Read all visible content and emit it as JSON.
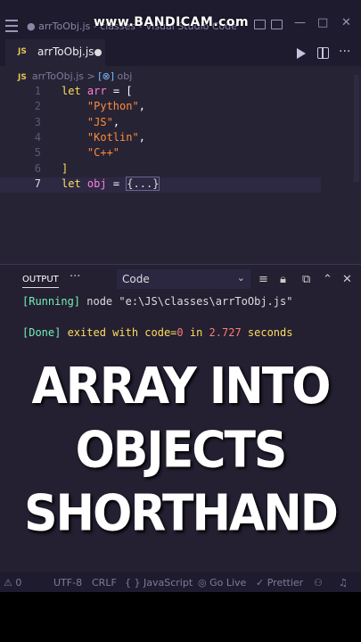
{
  "window": {
    "title": "● arrToObj.js - classes - Visual Studio Code",
    "watermark": "www.BANDICAM.com",
    "controls": [
      "—",
      "□",
      "✕"
    ]
  },
  "tab": {
    "badge": "JS",
    "label": "arrToObj.js",
    "modified": true
  },
  "breadcrumb": {
    "file": "arrToObj.js",
    "sep": ">",
    "symbol": "obj"
  },
  "code_lines": [
    {
      "n": "1",
      "parts": [
        [
          "kw",
          "let"
        ],
        [
          "op",
          " "
        ],
        [
          "var",
          "arr"
        ],
        [
          "op",
          " = ["
        ]
      ]
    },
    {
      "n": "2",
      "parts": [
        [
          "op",
          "    "
        ],
        [
          "str",
          "\"Python\""
        ],
        [
          "op",
          ","
        ]
      ]
    },
    {
      "n": "3",
      "parts": [
        [
          "op",
          "    "
        ],
        [
          "str",
          "\"JS\""
        ],
        [
          "op",
          ","
        ]
      ]
    },
    {
      "n": "4",
      "parts": [
        [
          "op",
          "    "
        ],
        [
          "str",
          "\"Kotlin\""
        ],
        [
          "op",
          ","
        ]
      ]
    },
    {
      "n": "5",
      "parts": [
        [
          "op",
          "    "
        ],
        [
          "str",
          "\"C++\""
        ]
      ]
    },
    {
      "n": "6",
      "parts": [
        [
          "kw",
          "]"
        ]
      ]
    },
    {
      "n": "7",
      "parts": [
        [
          "kw",
          "let"
        ],
        [
          "op",
          " "
        ],
        [
          "var",
          "obj"
        ],
        [
          "op",
          " = "
        ],
        [
          "fold",
          "{...}"
        ]
      ]
    }
  ],
  "panel": {
    "tab": "OUTPUT",
    "more": "···",
    "select_value": "Code",
    "running": {
      "bracket": "[Running]",
      "text": " node \"e:\\JS\\classes\\arrToObj.js\""
    },
    "done": {
      "bracket": "[Done]",
      "text1": " exited with ",
      "code_label": "code=",
      "code": "0",
      "text2": " in ",
      "time": "2.727",
      "text3": " seconds"
    }
  },
  "overlay": {
    "line1": "ARRAY INTO",
    "line2": "OBJECTS",
    "line3": "SHORTHAND"
  },
  "statusbar": {
    "problems": "0",
    "encoding": "UTF-8",
    "eol": "CRLF",
    "language": "JavaScript",
    "golive": "Go Live",
    "prettier": "Prettier"
  },
  "colors": {
    "accent": "#c94f8a",
    "keyword": "#fede5d",
    "variable": "#ff7edb",
    "string": "#ff8b39"
  }
}
